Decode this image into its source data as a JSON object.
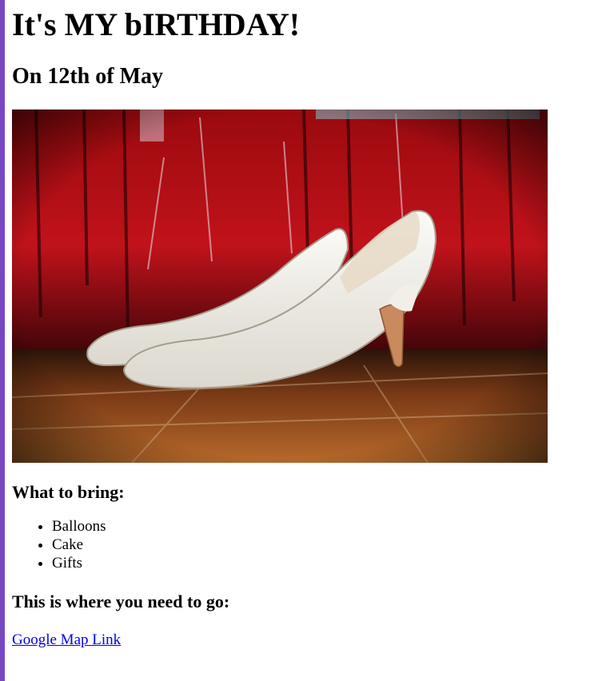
{
  "page": {
    "title": "It's MY bIRTHDAY!",
    "subtitle": "On 12th of May",
    "bring_heading": "What to bring:",
    "bring_items": [
      "Balloons",
      "Cake",
      "Gifts"
    ],
    "go_heading": "This is where you need to go:",
    "map_link_label": "Google Map Link"
  },
  "colors": {
    "accent_bar": "#7a47c4",
    "link": "#0000ee"
  }
}
